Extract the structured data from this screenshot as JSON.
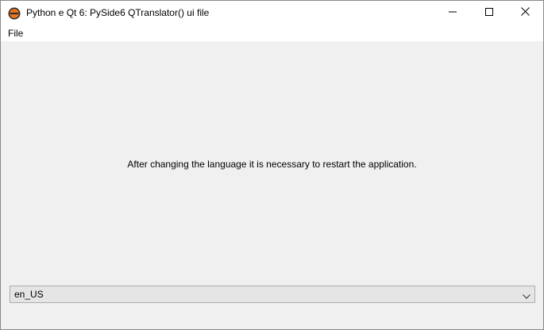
{
  "window": {
    "title": "Python e Qt 6: PySide6 QTranslator() ui file"
  },
  "menu": {
    "file": "File"
  },
  "main": {
    "info_text": "After changing the language it is necessary to restart the application."
  },
  "language_combo": {
    "selected": "en_US"
  },
  "icons": {
    "app": "python-qt-logo-icon",
    "minimize": "minimize-icon",
    "maximize": "maximize-icon",
    "close": "close-icon",
    "dropdown": "chevron-down-icon"
  },
  "colors": {
    "logo_orange": "#e8731f",
    "logo_dark": "#2b2b2b"
  }
}
